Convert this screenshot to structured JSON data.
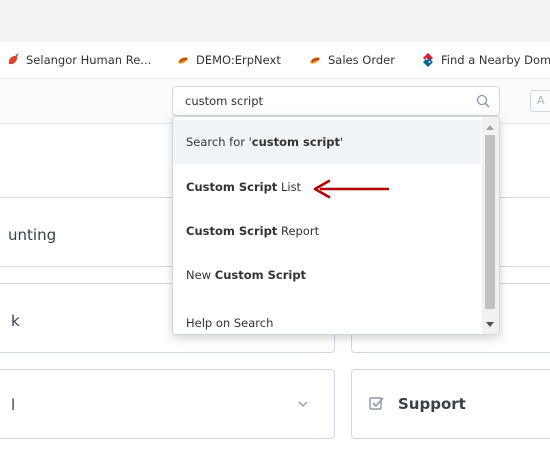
{
  "bookmarks": [
    {
      "label": "Selangor Human Re...",
      "icon": "red-pepper-icon"
    },
    {
      "label": "DEMO:ErpNext",
      "icon": "chili-icon"
    },
    {
      "label": "Sales Order",
      "icon": "chili-icon"
    },
    {
      "label": "Find a Nearby Dom",
      "icon": "dominos-icon"
    }
  ],
  "search": {
    "value": "custom script",
    "right_box_text": "A"
  },
  "dropdown": {
    "items": [
      {
        "prefix": "Search for '",
        "bold": "custom script",
        "suffix": "'"
      },
      {
        "bold": "Custom Script",
        "suffix": " List"
      },
      {
        "bold": "Custom Script",
        "suffix": " Report"
      },
      {
        "prefix": "New ",
        "bold": "Custom Script",
        "suffix": ""
      },
      {
        "label": "Help on Search"
      }
    ]
  },
  "cards": {
    "accounting_label": "unting",
    "second_label": "k",
    "third_label": "l",
    "support_label": "Support"
  },
  "colors": {
    "annotation_arrow": "#b30000",
    "border": "#d1d8dd"
  }
}
